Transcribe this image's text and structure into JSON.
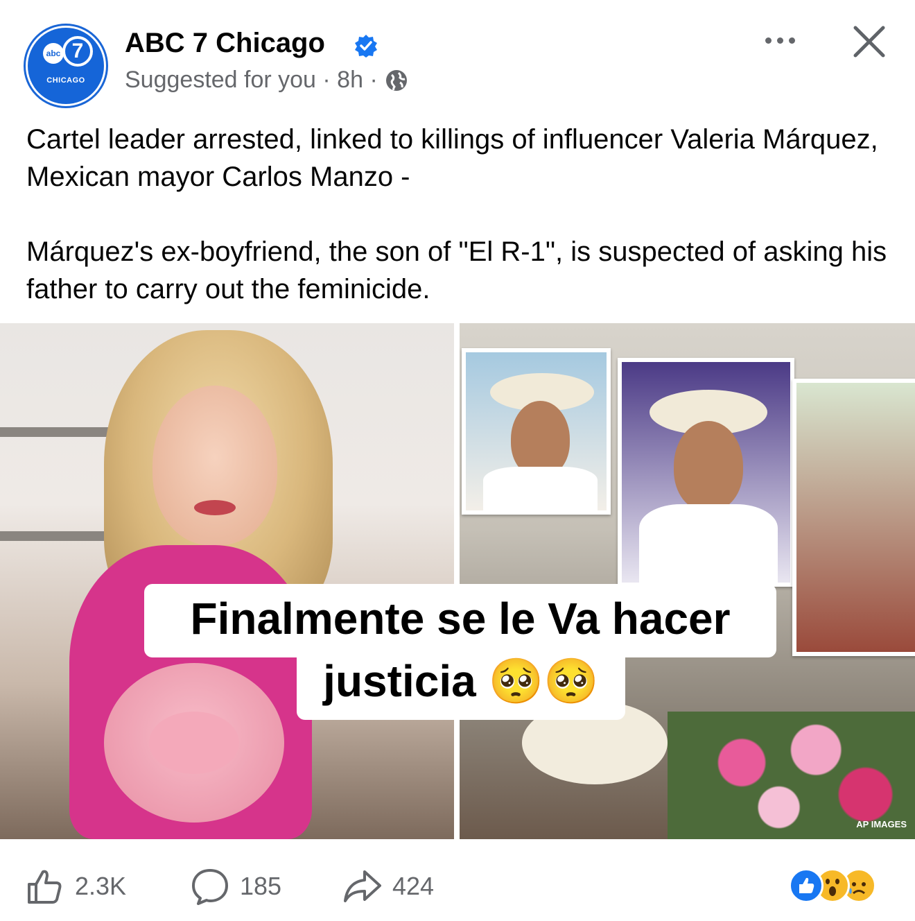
{
  "post": {
    "page_name": "ABC 7 Chicago",
    "verified": true,
    "avatar_brand": "abc",
    "avatar_number": "7",
    "avatar_label": "CHICAGO",
    "meta": "Suggested for you · 8h ·",
    "audience_icon": "globe-icon",
    "text_paragraphs": [
      "Cartel leader arrested, linked to killings of influencer Valeria Márquez, Mexican mayor Carlos Manzo -",
      "Márquez's ex-boyfriend, the son of \"El R-1\", is suspected of asking his father to carry out the feminicide."
    ],
    "image": {
      "caption_line1": "Finalmente se le Va hacer",
      "caption_line2": "justicia 🥺🥺",
      "credit": "AP IMAGES"
    }
  },
  "actions": {
    "like_count": "2.3K",
    "comment_count": "185",
    "share_count": "424",
    "reactions": [
      "like",
      "wow",
      "sad"
    ]
  },
  "colors": {
    "brand_blue": "#1565d8",
    "verified_blue": "#1877f2",
    "secondary_text": "#65676b"
  }
}
